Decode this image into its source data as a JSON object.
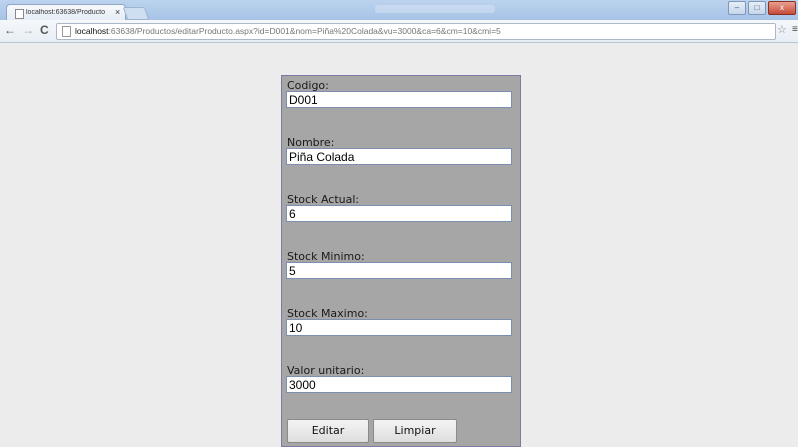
{
  "browser": {
    "tab_title": "localhost:63638/Producto",
    "tab_close": "×",
    "url_host": "localhost",
    "url_rest": ":63638/Productos/editarProducto.aspx?id=D001&nom=Piña%20Colada&vu=3000&ca=6&cm=10&cmi=5",
    "back_glyph": "←",
    "forward_glyph": "→",
    "reload_glyph": "C",
    "star_glyph": "☆",
    "menu_glyph": "≡",
    "window_buttons": {
      "minimize": "–",
      "maximize": "□",
      "close": "x"
    }
  },
  "form": {
    "fields": [
      {
        "label": "Codigo:",
        "value": "D001"
      },
      {
        "label": "Nombre:",
        "value": "Piña Colada"
      },
      {
        "label": "Stock Actual:",
        "value": "6"
      },
      {
        "label": "Stock Minimo:",
        "value": "5"
      },
      {
        "label": "Stock Maximo:",
        "value": "10"
      },
      {
        "label": "Valor unitario:",
        "value": "3000"
      }
    ],
    "buttons": {
      "edit": "Editar",
      "clear": "Limpiar"
    }
  },
  "colors": {
    "panel_bg": "#a6a6a6",
    "panel_border": "#7e7aa8",
    "page_bg": "#ececec"
  },
  "icons": {
    "tab_favicon": "page-icon",
    "back": "back-arrow-icon",
    "forward": "forward-arrow-icon",
    "reload": "reload-icon",
    "bookmark": "star-icon",
    "menu": "menu-icon"
  }
}
